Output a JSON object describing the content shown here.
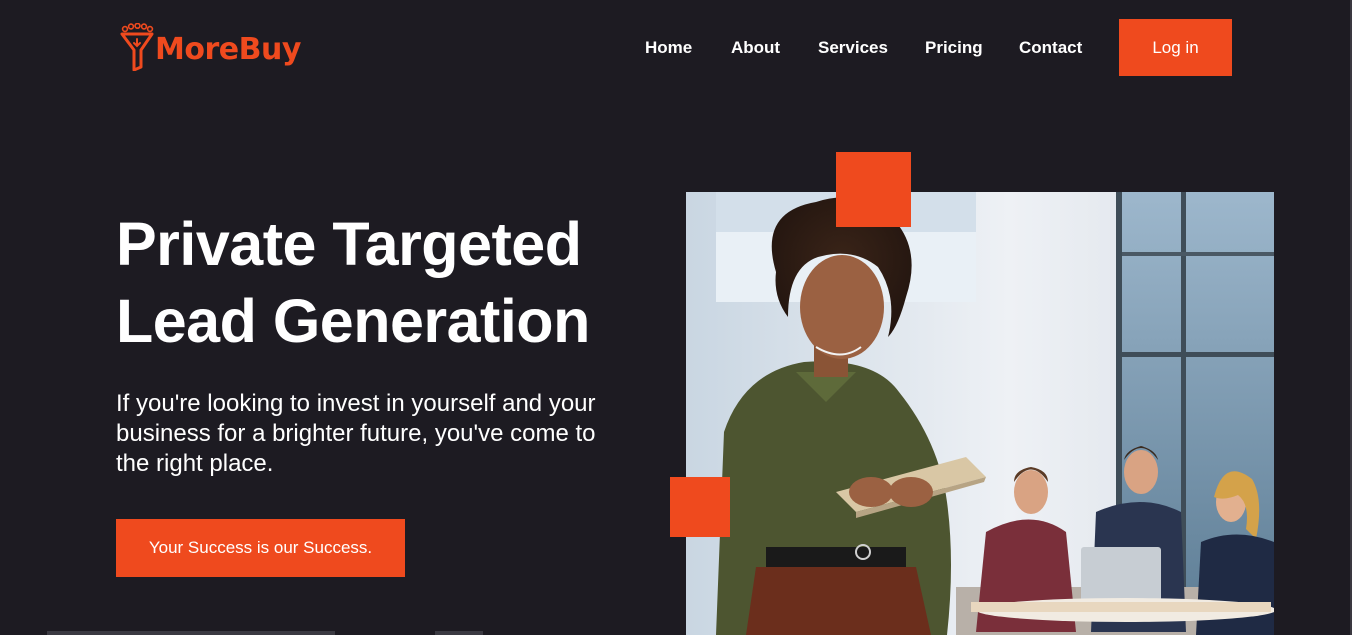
{
  "brand": {
    "name": "MoreBuy",
    "icon": "funnel-logo-icon",
    "color": "#ef4a1e"
  },
  "nav": {
    "items": [
      {
        "label": "Home"
      },
      {
        "label": "About"
      },
      {
        "label": "Services"
      },
      {
        "label": "Pricing"
      },
      {
        "label": "Contact"
      }
    ],
    "login_label": "Log in"
  },
  "hero": {
    "title_line1": "Private Targeted",
    "title_line2": "Lead Generation",
    "subtitle_line1": "If you're looking to invest in yourself and your",
    "subtitle_line2": "business for a brighter future, you've come to",
    "subtitle_line3": "the right place.",
    "cta_label": "Your Success is our Success."
  },
  "image": {
    "subject": "woman-with-tablet-photo"
  },
  "colors": {
    "background": "#1d1b22",
    "accent": "#ef4a1e",
    "text": "#ffffff"
  }
}
